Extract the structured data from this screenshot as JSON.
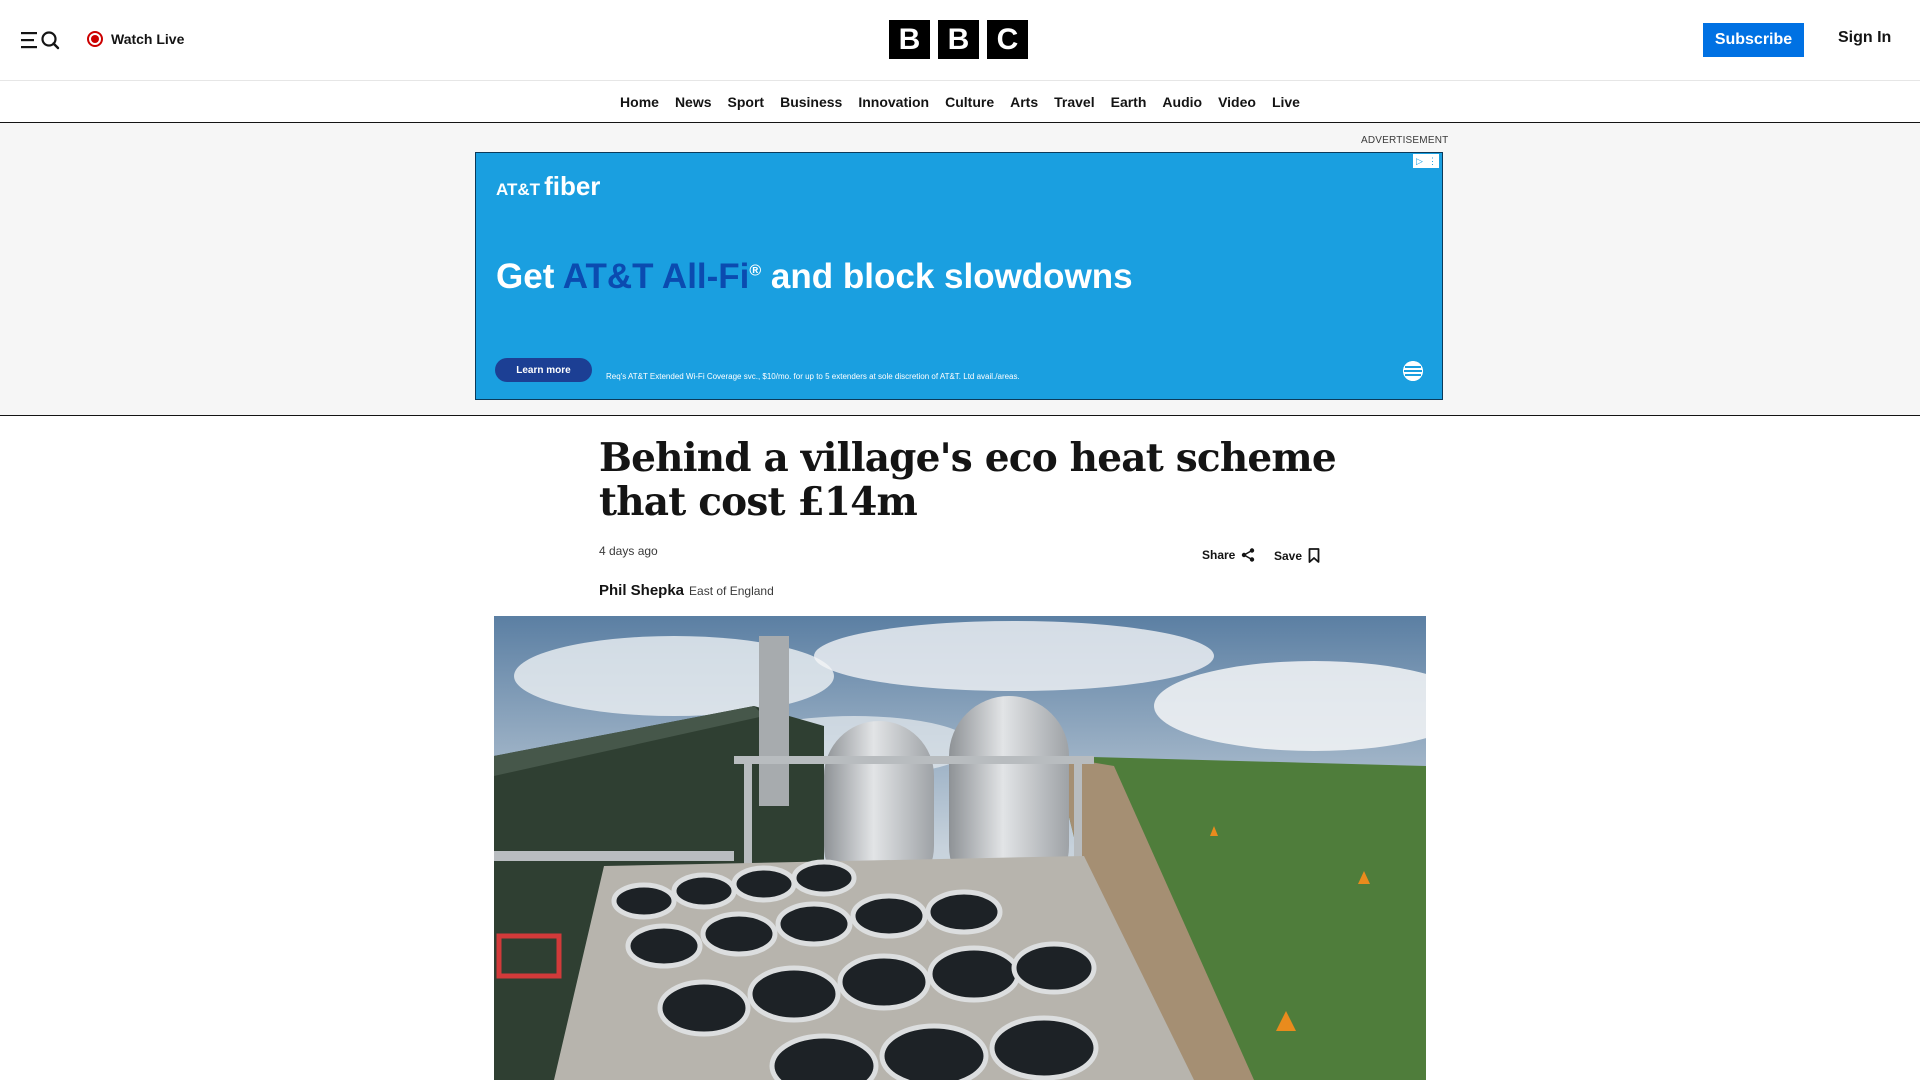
{
  "header": {
    "watch_live": "Watch Live",
    "logo_letters": [
      "B",
      "B",
      "C"
    ],
    "subscribe": "Subscribe",
    "sign_in": "Sign In",
    "icons": [
      "menu-icon",
      "search-icon",
      "live-icon"
    ]
  },
  "nav": {
    "items": [
      "Home",
      "News",
      "Sport",
      "Business",
      "Innovation",
      "Culture",
      "Arts",
      "Travel",
      "Earth",
      "Audio",
      "Video",
      "Live"
    ]
  },
  "ad": {
    "label": "ADVERTISEMENT",
    "brand_att": "AT&T",
    "brand_fiber": "fiber",
    "headline_start": "Get ",
    "headline_highlight": "AT&T All-Fi",
    "headline_mark": "®",
    "headline_end": " and block slowdowns",
    "cta": "Learn more",
    "disclaimer": "Req's AT&T Extended Wi-Fi Coverage svc., $10/mo. for up to 5 extenders at sole discretion of AT&T. Ltd avail./areas."
  },
  "article": {
    "headline": "Behind a village's eco heat scheme that cost £14m",
    "timestamp": "4 days ago",
    "share": "Share",
    "save": "Save",
    "author": "Phil Shepka",
    "location": "East of England"
  },
  "colors": {
    "subscribe_blue": "#0071e3",
    "ad_blue": "#1a9fe0",
    "ad_dark_blue": "#1c3f94",
    "live_red": "#cc0000"
  }
}
